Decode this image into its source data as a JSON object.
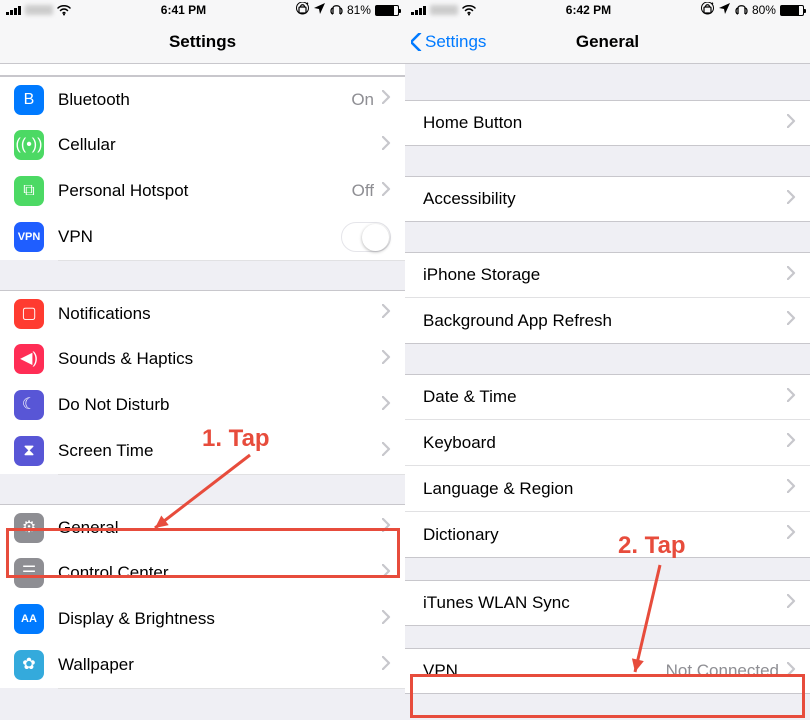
{
  "left": {
    "status": {
      "time": "6:41 PM",
      "battery_pct": "81%",
      "battery_fill": 81
    },
    "nav": {
      "title": "Settings"
    },
    "groups": [
      {
        "cells": [
          {
            "id": "bluetooth",
            "label": "Bluetooth",
            "value": "On",
            "chevron": true,
            "icon_color": "ic-blue",
            "icon": "bluetooth"
          },
          {
            "id": "cellular",
            "label": "Cellular",
            "chevron": true,
            "icon_color": "ic-green",
            "icon": "antenna"
          },
          {
            "id": "hotspot",
            "label": "Personal Hotspot",
            "value": "Off",
            "chevron": true,
            "icon_color": "ic-green",
            "icon": "link"
          },
          {
            "id": "vpn",
            "label": "VPN",
            "toggle": true,
            "toggle_on": false,
            "icon_color": "ic-navy",
            "icon": "vpn"
          }
        ]
      },
      {
        "cells": [
          {
            "id": "notifications",
            "label": "Notifications",
            "chevron": true,
            "icon_color": "ic-red",
            "icon": "notif"
          },
          {
            "id": "sounds",
            "label": "Sounds & Haptics",
            "chevron": true,
            "icon_color": "ic-rose",
            "icon": "sound"
          },
          {
            "id": "dnd",
            "label": "Do Not Disturb",
            "chevron": true,
            "icon_color": "ic-indigo",
            "icon": "moon"
          },
          {
            "id": "screentime",
            "label": "Screen Time",
            "chevron": true,
            "icon_color": "ic-indigo",
            "icon": "hourglass"
          }
        ]
      },
      {
        "cells": [
          {
            "id": "general",
            "label": "General",
            "chevron": true,
            "icon_color": "ic-gray",
            "icon": "gear",
            "highlight": true
          },
          {
            "id": "control-center",
            "label": "Control Center",
            "chevron": true,
            "icon_color": "ic-gray",
            "icon": "switches"
          },
          {
            "id": "display",
            "label": "Display & Brightness",
            "chevron": true,
            "icon_color": "ic-blue",
            "icon": "aa"
          },
          {
            "id": "wallpaper",
            "label": "Wallpaper",
            "chevron": true,
            "icon_color": "ic-cyan",
            "icon": "flower"
          }
        ]
      }
    ]
  },
  "right": {
    "status": {
      "time": "6:42 PM",
      "battery_pct": "80%",
      "battery_fill": 80
    },
    "nav": {
      "title": "General",
      "back": "Settings"
    },
    "groups": [
      {
        "cells": [
          {
            "id": "home-button",
            "label": "Home Button",
            "chevron": true
          }
        ]
      },
      {
        "cells": [
          {
            "id": "accessibility",
            "label": "Accessibility",
            "chevron": true
          }
        ]
      },
      {
        "cells": [
          {
            "id": "iphone-storage",
            "label": "iPhone Storage",
            "chevron": true
          },
          {
            "id": "bg-refresh",
            "label": "Background App Refresh",
            "chevron": true
          }
        ]
      },
      {
        "cells": [
          {
            "id": "date-time",
            "label": "Date & Time",
            "chevron": true
          },
          {
            "id": "keyboard",
            "label": "Keyboard",
            "chevron": true
          },
          {
            "id": "lang-region",
            "label": "Language & Region",
            "chevron": true
          },
          {
            "id": "dictionary",
            "label": "Dictionary",
            "chevron": true
          }
        ]
      },
      {
        "cells": [
          {
            "id": "itunes-wlan",
            "label": "iTunes WLAN Sync",
            "chevron": true
          }
        ]
      },
      {
        "cells": [
          {
            "id": "vpn-general",
            "label": "VPN",
            "value": "Not Connected",
            "chevron": true,
            "highlight": true
          }
        ]
      }
    ]
  },
  "annotations": {
    "step1": "1. Tap",
    "step2": "2. Tap"
  }
}
